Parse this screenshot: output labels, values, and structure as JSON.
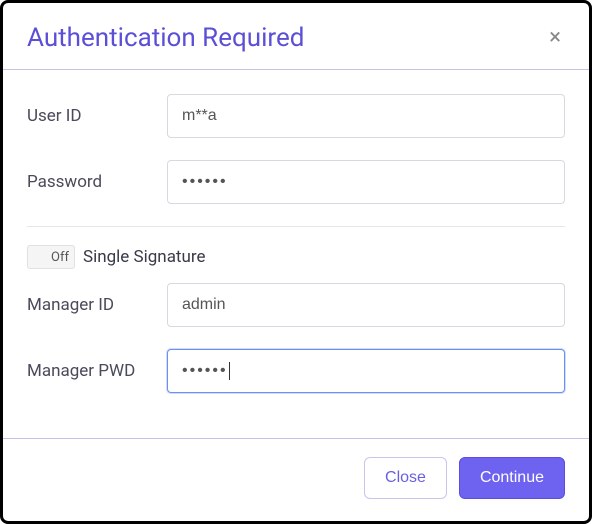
{
  "modal": {
    "title": "Authentication Required"
  },
  "fields": {
    "user_id": {
      "label": "User ID",
      "value": "m**a"
    },
    "password": {
      "label": "Password",
      "value": "••••••"
    },
    "single_signature": {
      "toggle_state": "Off",
      "label": "Single Signature"
    },
    "manager_id": {
      "label": "Manager ID",
      "value": "admin"
    },
    "manager_pwd": {
      "label": "Manager PWD",
      "value": "••••••"
    }
  },
  "buttons": {
    "close": "Close",
    "continue": "Continue"
  }
}
